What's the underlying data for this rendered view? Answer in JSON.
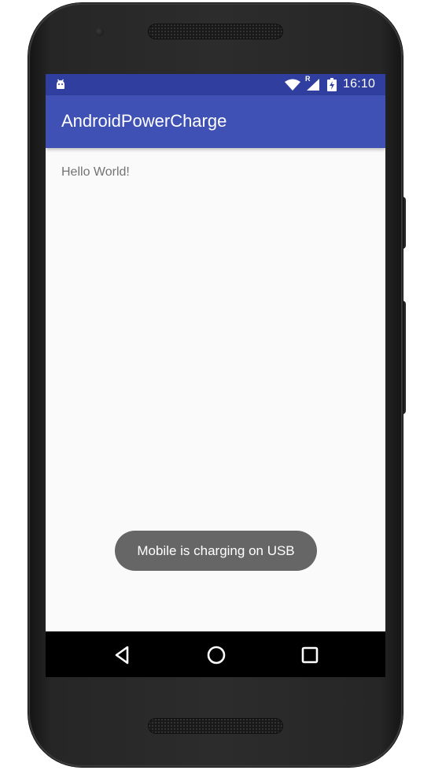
{
  "device": {
    "model_hint": "android-phone-frame"
  },
  "status_bar": {
    "left_icon": "android-notification-icon",
    "icons": [
      "wifi-icon",
      "roaming-indicator",
      "cellular-signal-icon",
      "battery-charging-icon"
    ],
    "roaming_label": "R",
    "time": "16:10",
    "color": "#303f9f"
  },
  "app_bar": {
    "title": "AndroidPowerCharge",
    "color": "#3f51b5"
  },
  "main": {
    "text": "Hello World!"
  },
  "toast": {
    "message": "Mobile is charging on USB"
  },
  "nav_bar": {
    "buttons": [
      "back-icon",
      "home-icon",
      "recents-icon"
    ]
  }
}
